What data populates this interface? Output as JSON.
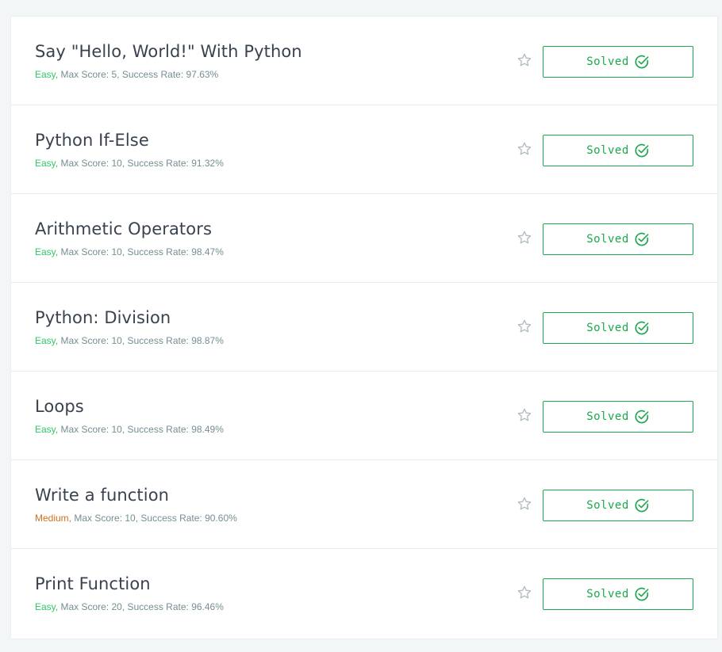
{
  "colors": {
    "easy": "#2ec866",
    "medium": "#d2721c",
    "solved": "#1ba94c",
    "title": "#39424e",
    "meta": "#738f93"
  },
  "icons": {
    "star": "star-outline-icon",
    "check": "check-circle-icon"
  },
  "challenges": [
    {
      "title": "Say \"Hello, World!\" With Python",
      "difficulty": "Easy,",
      "difficulty_level": "easy",
      "details": " Max Score: 5, Success Rate: 97.63%",
      "status": "Solved"
    },
    {
      "title": "Python If-Else",
      "difficulty": "Easy,",
      "difficulty_level": "easy",
      "details": " Max Score: 10, Success Rate: 91.32%",
      "status": "Solved"
    },
    {
      "title": "Arithmetic Operators",
      "difficulty": "Easy,",
      "difficulty_level": "easy",
      "details": " Max Score: 10, Success Rate: 98.47%",
      "status": "Solved"
    },
    {
      "title": "Python: Division",
      "difficulty": "Easy,",
      "difficulty_level": "easy",
      "details": " Max Score: 10, Success Rate: 98.87%",
      "status": "Solved"
    },
    {
      "title": "Loops",
      "difficulty": "Easy,",
      "difficulty_level": "easy",
      "details": " Max Score: 10, Success Rate: 98.49%",
      "status": "Solved"
    },
    {
      "title": "Write a function",
      "difficulty": "Medium,",
      "difficulty_level": "medium",
      "details": " Max Score: 10, Success Rate: 90.60%",
      "status": "Solved"
    },
    {
      "title": "Print Function",
      "difficulty": "Easy,",
      "difficulty_level": "easy",
      "details": " Max Score: 20, Success Rate: 96.46%",
      "status": "Solved"
    }
  ]
}
